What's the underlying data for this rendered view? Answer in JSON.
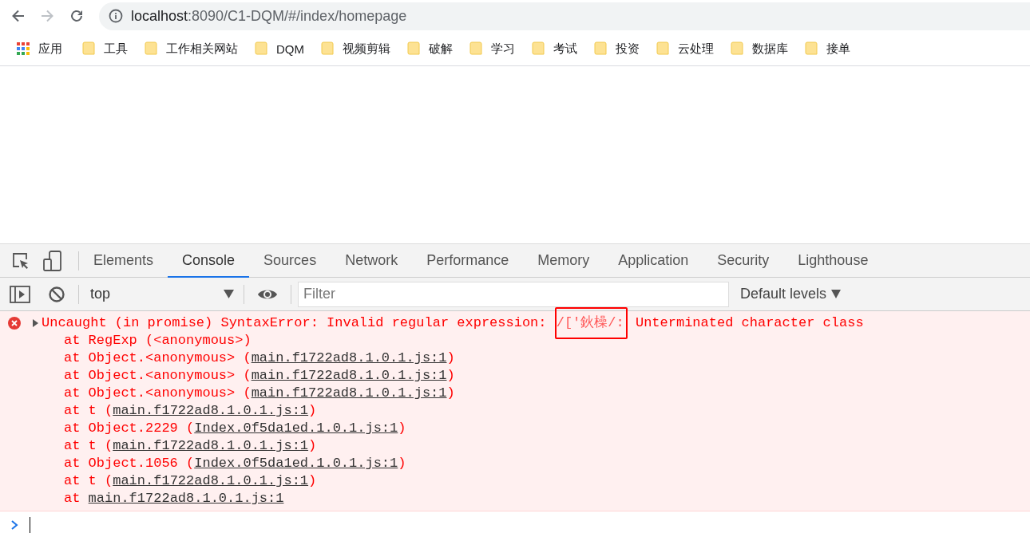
{
  "navigation": {
    "back_enabled": true,
    "forward_enabled": false
  },
  "address_bar": {
    "host": "localhost",
    "path": ":8090/C1-DQM/#/index/homepage"
  },
  "bookmarks": [
    {
      "kind": "apps",
      "label": "应用"
    },
    {
      "kind": "folder",
      "label": "工具"
    },
    {
      "kind": "folder",
      "label": "工作相关网站"
    },
    {
      "kind": "folder",
      "label": "DQM"
    },
    {
      "kind": "folder",
      "label": "视频剪辑"
    },
    {
      "kind": "folder",
      "label": "破解"
    },
    {
      "kind": "folder",
      "label": "学习"
    },
    {
      "kind": "folder",
      "label": "考试"
    },
    {
      "kind": "folder",
      "label": "投资"
    },
    {
      "kind": "folder",
      "label": "云处理"
    },
    {
      "kind": "folder",
      "label": "数据库"
    },
    {
      "kind": "folder",
      "label": "接单"
    }
  ],
  "devtools": {
    "tabs": [
      {
        "label": "Elements",
        "selected": false
      },
      {
        "label": "Console",
        "selected": true
      },
      {
        "label": "Sources",
        "selected": false
      },
      {
        "label": "Network",
        "selected": false
      },
      {
        "label": "Performance",
        "selected": false
      },
      {
        "label": "Memory",
        "selected": false
      },
      {
        "label": "Application",
        "selected": false
      },
      {
        "label": "Security",
        "selected": false
      },
      {
        "label": "Lighthouse",
        "selected": false
      }
    ],
    "context": "top",
    "filter": {
      "placeholder": "Filter"
    },
    "levels": "Default levels",
    "messages": [
      {
        "kind": "error",
        "expanded": false,
        "text_before": "Uncaught (in promise) SyntaxError: Invalid regular expression: ",
        "highlight": "/['鈥橾/:",
        "text_after": " Unterminated character class",
        "stack": [
          {
            "prefix": "at RegExp (<anonymous>)"
          },
          {
            "prefix": "at Object.<anonymous> (",
            "link": "main.f1722ad8.1.0.1.js:1",
            "suffix": ")"
          },
          {
            "prefix": "at Object.<anonymous> (",
            "link": "main.f1722ad8.1.0.1.js:1",
            "suffix": ")"
          },
          {
            "prefix": "at Object.<anonymous> (",
            "link": "main.f1722ad8.1.0.1.js:1",
            "suffix": ")"
          },
          {
            "prefix": "at t (",
            "link": "main.f1722ad8.1.0.1.js:1",
            "suffix": ")"
          },
          {
            "prefix": "at Object.2229 (",
            "link": "Index.0f5da1ed.1.0.1.js:1",
            "suffix": ")"
          },
          {
            "prefix": "at t (",
            "link": "main.f1722ad8.1.0.1.js:1",
            "suffix": ")"
          },
          {
            "prefix": "at Object.1056 (",
            "link": "Index.0f5da1ed.1.0.1.js:1",
            "suffix": ")"
          },
          {
            "prefix": "at t (",
            "link": "main.f1722ad8.1.0.1.js:1",
            "suffix": ")"
          },
          {
            "prefix": "at ",
            "link": "main.f1722ad8.1.0.1.js:1"
          }
        ]
      }
    ]
  }
}
